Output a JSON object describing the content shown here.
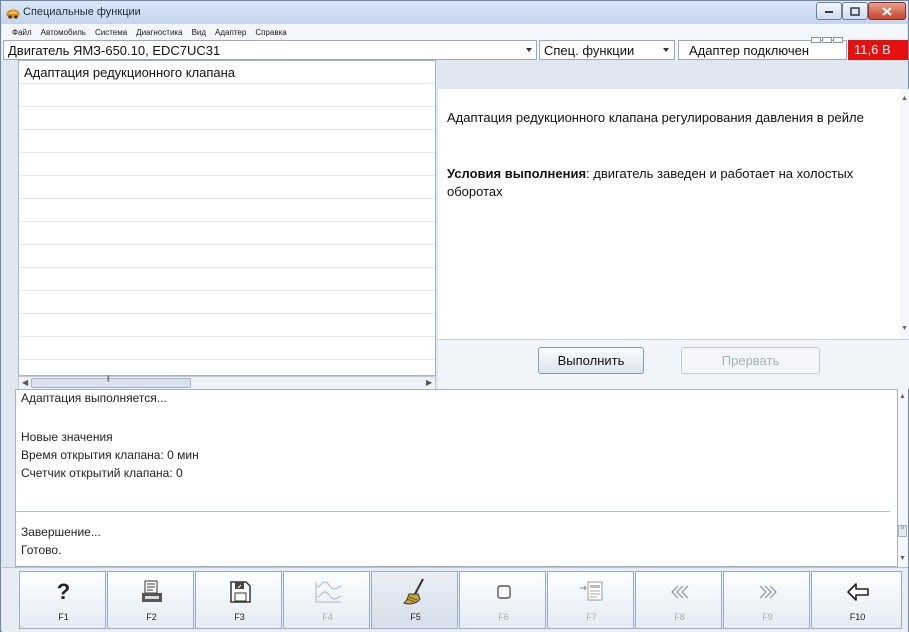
{
  "window": {
    "title": "Специальные функции",
    "title_icon": "car-app-icon"
  },
  "menu": [
    "Файл",
    "Автомобиль",
    "Система",
    "Диагностика",
    "Вид",
    "Адаптер",
    "Справка"
  ],
  "toolbar": {
    "engine": "Двигатель ЯМЗ-650.10, EDC7UC31",
    "function_mode": "Спец. функции",
    "adapter_status": "Адаптер подключен",
    "voltage": "11,6 В",
    "voltage_color": "#e8100f"
  },
  "function_list": {
    "items": [
      "Адаптация редукционного клапана"
    ]
  },
  "description": {
    "text": "Адаптация редукционного клапана регулирования давления в рейле",
    "conditions_label": "Условия выполнения",
    "conditions_text": ": двигатель заведен и работает на холостых оборотах"
  },
  "actions": {
    "run": "Выполнить",
    "stop": "Прервать"
  },
  "log": {
    "lines": [
      "Адаптация выполняется...",
      "Новые значения",
      "Время открытия клапана: 0 мин",
      "Счетчик открытий клапана: 0",
      "Завершение...",
      "Готово."
    ]
  },
  "fkeys": [
    {
      "label": "F1",
      "icon": "help-icon",
      "enabled": true
    },
    {
      "label": "F2",
      "icon": "print-icon",
      "enabled": true
    },
    {
      "label": "F3",
      "icon": "save-icon",
      "enabled": true
    },
    {
      "label": "F4",
      "icon": "graph-icon",
      "enabled": false
    },
    {
      "label": "F5",
      "icon": "brush-icon",
      "enabled": true
    },
    {
      "label": "F6",
      "icon": "stop-square-icon",
      "enabled": false
    },
    {
      "label": "F7",
      "icon": "import-icon",
      "enabled": false
    },
    {
      "label": "F8",
      "icon": "rewind-icon",
      "enabled": false
    },
    {
      "label": "F9",
      "icon": "forward-icon",
      "enabled": false
    },
    {
      "label": "F10",
      "icon": "exit-icon",
      "enabled": true
    }
  ]
}
